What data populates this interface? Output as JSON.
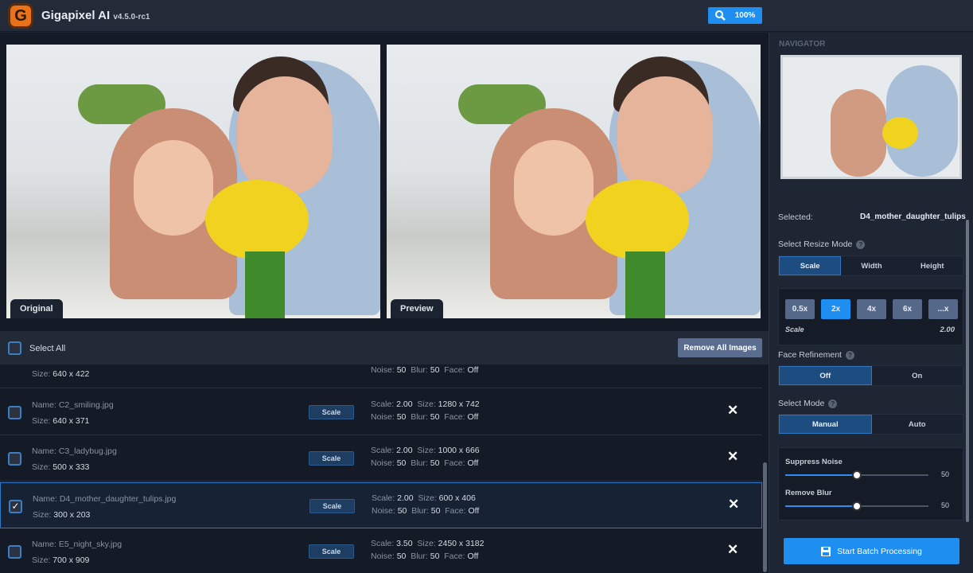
{
  "app": {
    "name": "Gigapixel AI",
    "version": "v4.5.0-rc1",
    "logo_letter": "G",
    "zoom": "100%"
  },
  "preview": {
    "original_label": "Original",
    "preview_label": "Preview"
  },
  "list_header": {
    "select_all": "Select All",
    "remove_all": "Remove All Images"
  },
  "images": [
    {
      "name": "",
      "size": "640 x 422",
      "scale": "",
      "out_size": "",
      "noise": "50",
      "blur": "50",
      "face": "Off",
      "checked": false,
      "partial": true
    },
    {
      "name": "C2_smiling.jpg",
      "size": "640 x 371",
      "scale": "2.00",
      "out_size": "1280 x 742",
      "noise": "50",
      "blur": "50",
      "face": "Off",
      "checked": false
    },
    {
      "name": "C3_ladybug.jpg",
      "size": "500 x 333",
      "scale": "2.00",
      "out_size": "1000 x 666",
      "noise": "50",
      "blur": "50",
      "face": "Off",
      "checked": false
    },
    {
      "name": "D4_mother_daughter_tulips.jpg",
      "size": "300 x 203",
      "scale": "2.00",
      "out_size": "600 x 406",
      "noise": "50",
      "blur": "50",
      "face": "Off",
      "checked": true
    },
    {
      "name": "E5_night_sky.jpg",
      "size": "700 x 909",
      "scale": "3.50",
      "out_size": "2450 x 3182",
      "noise": "50",
      "blur": "50",
      "face": "Off",
      "checked": false
    }
  ],
  "row_labels": {
    "name": "Name: ",
    "size": "Size: ",
    "scale": "Scale: ",
    "noise": "Noise: ",
    "blur": "Blur: ",
    "face": "Face: ",
    "mode_button": "Scale"
  },
  "sidebar": {
    "navigator": "NAVIGATOR",
    "selected_label": "Selected:",
    "selected_value": "D4_mother_daughter_tulips",
    "resize_mode_label": "Select Resize Mode",
    "resize_modes": [
      "Scale",
      "Width",
      "Height"
    ],
    "scale_options": [
      "0.5x",
      "2x",
      "4x",
      "6x",
      "...x"
    ],
    "scale_label": "Scale",
    "scale_value": "2.00",
    "face_label": "Face Refinement",
    "face_options": [
      "Off",
      "On"
    ],
    "mode_label": "Select Mode",
    "mode_options": [
      "Manual",
      "Auto"
    ],
    "suppress_noise": {
      "label": "Suppress Noise",
      "value": "50"
    },
    "remove_blur": {
      "label": "Remove Blur",
      "value": "50"
    },
    "batch_button": "Start Batch Processing",
    "help": "?"
  }
}
